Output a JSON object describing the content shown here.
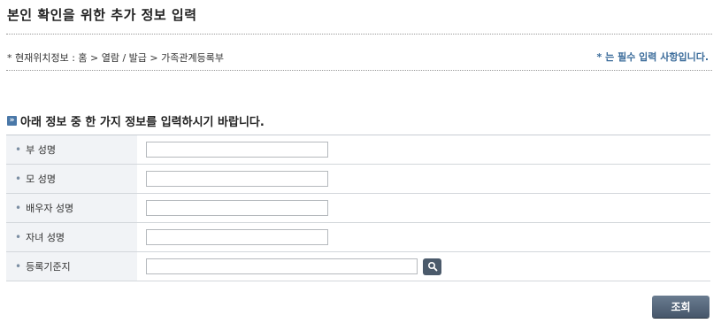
{
  "page": {
    "title": "본인 확인을 위한 추가 정보 입력",
    "breadcrumb": "* 현재위치정보 : 홈 > 열람 / 발급 > 가족관계등록부",
    "required_note": "* 는 필수 입력 사항입니다."
  },
  "section": {
    "title": "아래 정보 중 한 가지 정보를 입력하시기 바랍니다."
  },
  "form": {
    "fields": [
      {
        "label": "부 성명",
        "value": ""
      },
      {
        "label": "모 성명",
        "value": ""
      },
      {
        "label": "배우자 성명",
        "value": ""
      },
      {
        "label": "자녀 성명",
        "value": ""
      },
      {
        "label": "등록기준지",
        "value": ""
      }
    ],
    "bullet": "•",
    "submit_label": "조회"
  },
  "icons": {
    "section": "arrow-right-icon",
    "search": "search-icon"
  }
}
